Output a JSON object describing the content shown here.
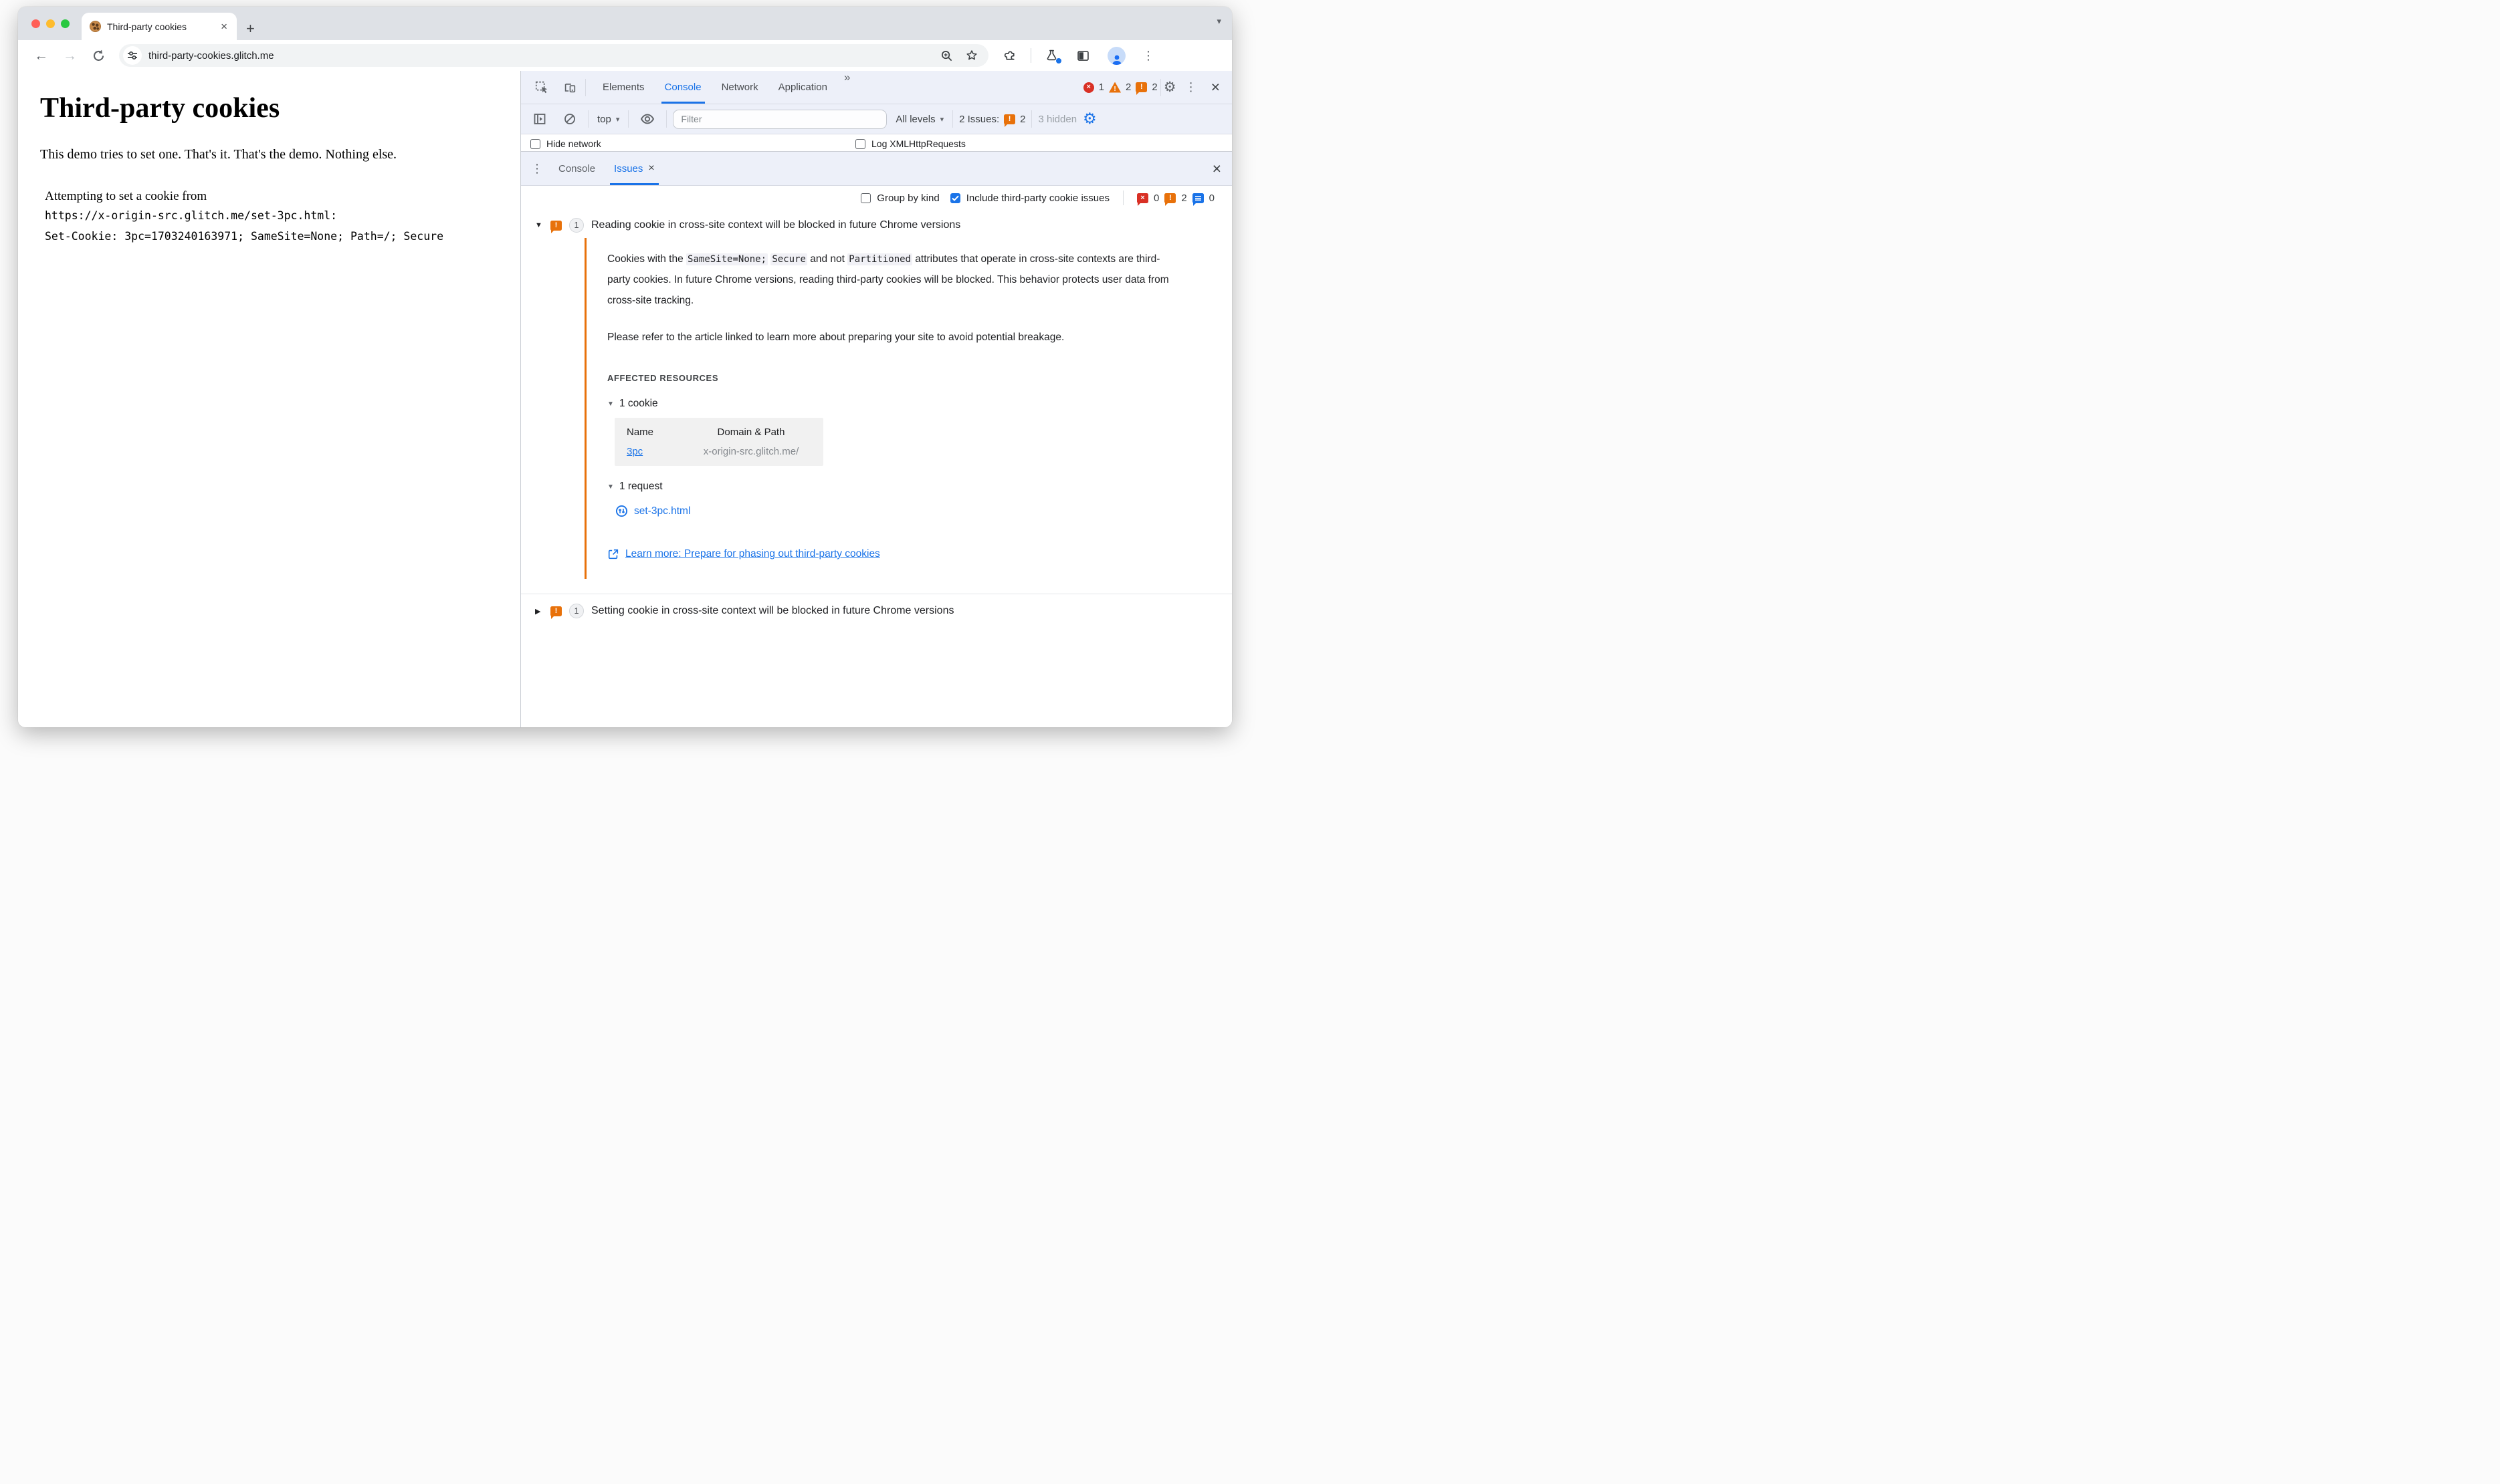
{
  "browser": {
    "tab_title": "Third-party cookies",
    "url": "third-party-cookies.glitch.me"
  },
  "page": {
    "heading": "Third-party cookies",
    "lead": "This demo tries to set one. That's it. That's the demo. Nothing else.",
    "attempt_line": "Attempting to set a cookie from",
    "mono_line1": "https://x-origin-src.glitch.me/set-3pc.html:",
    "mono_line2": "Set-Cookie: 3pc=1703240163971; SameSite=None; Path=/; Secure"
  },
  "icons": {
    "tab_close": "×",
    "new_tab": "+",
    "tab_search": "▾",
    "back": "←",
    "forward": "→",
    "more_tabs": "»",
    "kebab": "⋮",
    "gear": "⚙",
    "close": "×",
    "caret": "▾",
    "expanded": "▼",
    "collapsed": "▶",
    "error_mark": "×",
    "warn_mark": "!",
    "check": "✓"
  },
  "devtools": {
    "tabs": [
      "Elements",
      "Console",
      "Network",
      "Application"
    ],
    "badge_errors": "1",
    "badge_warnings": "2",
    "badge_issues": "2",
    "console_toolbar": {
      "context": "top",
      "filter_placeholder": "Filter",
      "levels": "All levels",
      "issues_label": "2 Issues:",
      "issues_badge": "2",
      "hidden": "3 hidden"
    },
    "clipped_row": {
      "hide_network": "Hide network",
      "log_xhr": "Log XMLHttpRequests"
    },
    "drawer_tabs": {
      "console": "Console",
      "issues": "Issues"
    },
    "issues_toolbar": {
      "group_by_kind": "Group by kind",
      "include_third_party": "Include third-party cookie issues",
      "count_errors": "0",
      "count_breaking": "2",
      "count_info": "0"
    },
    "issue1": {
      "count": "1",
      "title": "Reading cookie in cross-site context will be blocked in future Chrome versions",
      "p1_t1": "Cookies with the ",
      "p1_c1": "SameSite=None;",
      "p1_c2": "Secure",
      "p1_t2": " and not ",
      "p1_c3": "Partitioned",
      "p1_t3": " attributes that operate in cross-site contexts are third-party cookies. In future Chrome versions, reading third-party cookies will be blocked. This behavior protects user data from cross-site tracking.",
      "p2": "Please refer to the article linked to learn more about preparing your site to avoid potential breakage.",
      "affected_heading": "AFFECTED RESOURCES",
      "cookie_group": "1 cookie",
      "table_header_name": "Name",
      "table_header_domain": "Domain & Path",
      "cookie_name": "3pc",
      "cookie_domain": "x-origin-src.glitch.me/",
      "request_group": "1 request",
      "request_file": "set-3pc.html",
      "learn_more": "Learn more: Prepare for phasing out third-party cookies"
    },
    "issue2": {
      "count": "1",
      "title": "Setting cookie in cross-site context will be blocked in future Chrome versions"
    }
  }
}
